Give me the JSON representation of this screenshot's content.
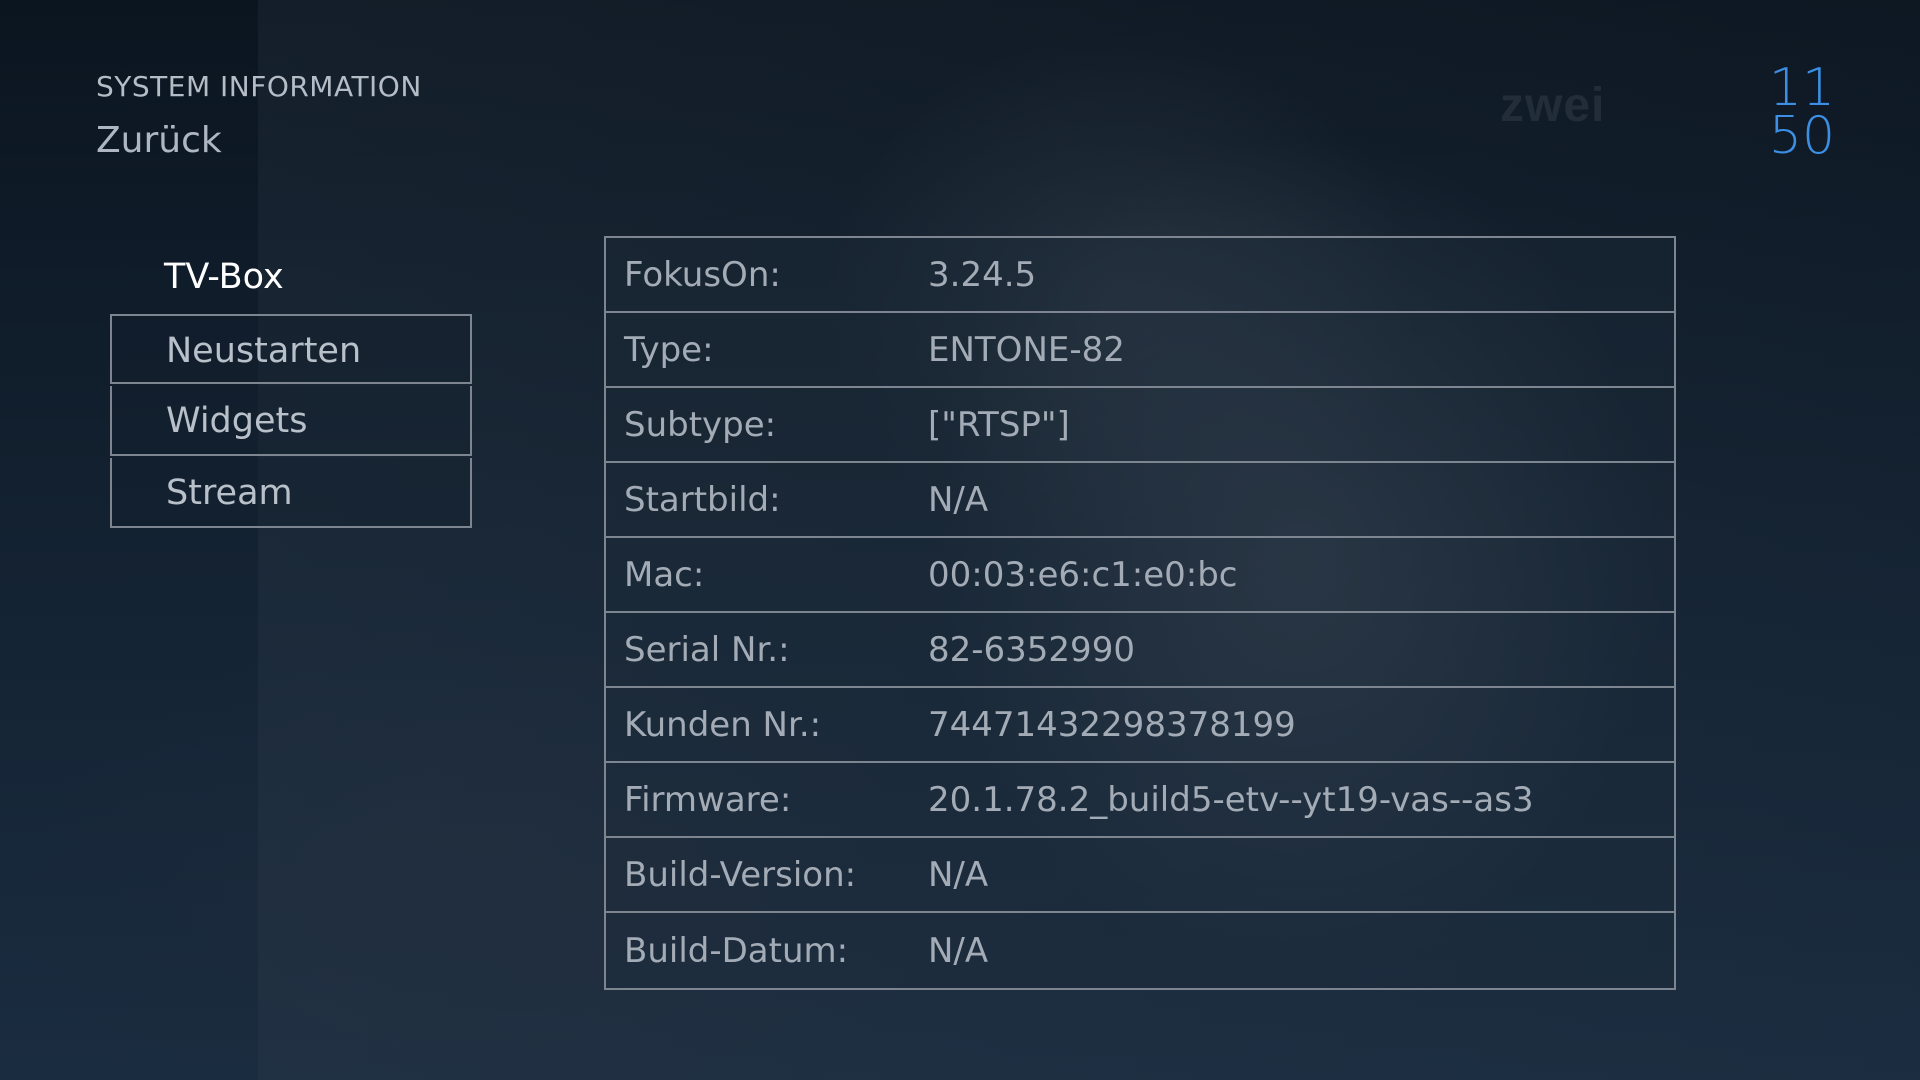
{
  "header": {
    "title": "SYSTEM INFORMATION",
    "back_label": "Zurück"
  },
  "clock": {
    "hours": "11",
    "minutes": "50"
  },
  "watermark": "zwei",
  "menu": {
    "items": [
      {
        "label": "TV-Box",
        "active": true
      },
      {
        "label": "Neustarten",
        "active": false
      },
      {
        "label": "Widgets",
        "active": false
      },
      {
        "label": "Stream",
        "active": false
      }
    ]
  },
  "info": {
    "rows": [
      {
        "label": "FokusOn:",
        "value": "3.24.5"
      },
      {
        "label": "Type:",
        "value": "ENTONE-82"
      },
      {
        "label": "Subtype:",
        "value": "[\"RTSP\"]"
      },
      {
        "label": "Startbild:",
        "value": "N/A"
      },
      {
        "label": "Mac:",
        "value": "00:03:e6:c1:e0:bc"
      },
      {
        "label": "Serial Nr.:",
        "value": "82-6352990"
      },
      {
        "label": "Kunden Nr.:",
        "value": "74471432298378199"
      },
      {
        "label": "Firmware:",
        "value": "20.1.78.2_build5-etv--yt19-vas--as3"
      },
      {
        "label": "Build-Version:",
        "value": "N/A"
      },
      {
        "label": "Build-Datum:",
        "value": "N/A"
      }
    ]
  },
  "colors": {
    "accent": "#2f86e0",
    "clock": "#3c8fe4",
    "border": "#7c8590",
    "text": "#a3acb6"
  }
}
